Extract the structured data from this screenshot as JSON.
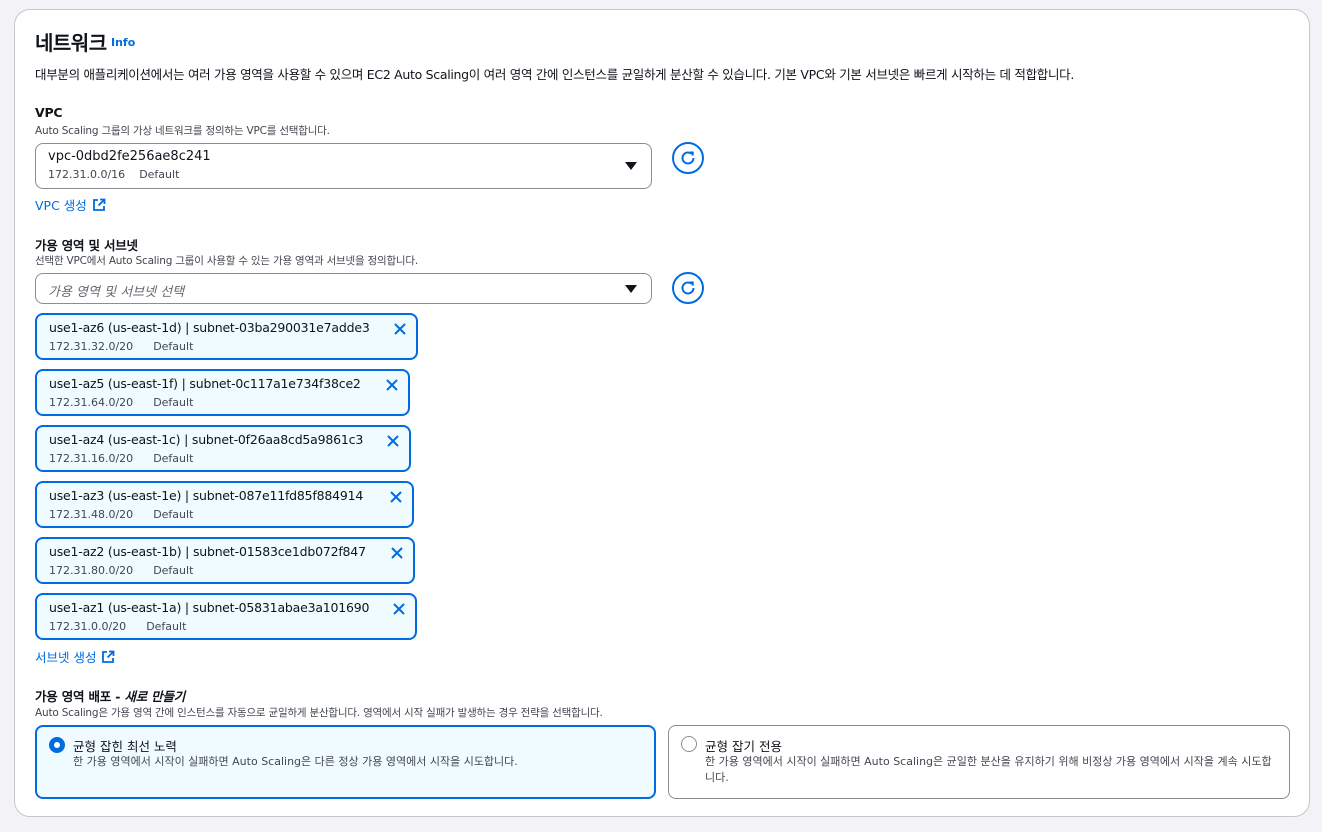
{
  "network": {
    "title": "네트워크",
    "info_link": "Info",
    "description": "대부분의 애플리케이션에서는 여러 가용 영역을 사용할 수 있으며 EC2 Auto Scaling이 여러 영역 간에 인스턴스를 균일하게 분산할 수 있습니다. 기본 VPC와 기본 서브넷은 빠르게 시작하는 데 적합합니다."
  },
  "vpc": {
    "label": "VPC",
    "description": "Auto Scaling 그룹의 가상 네트워크를 정의하는 VPC를 선택합니다.",
    "selected_id": "vpc-0dbd2fe256ae8c241",
    "selected_cidr": "172.31.0.0/16",
    "selected_tag": "Default",
    "create_link": "VPC 생성"
  },
  "subnets": {
    "label": "가용 영역 및 서브넷",
    "description": "선택한 VPC에서 Auto Scaling 그룹이 사용할 수 있는 가용 영역과 서브넷을 정의합니다.",
    "placeholder": "가용 영역 및 서브넷 선택",
    "selected": [
      {
        "name": "use1-az6 (us-east-1d) | subnet-03ba290031e7adde3",
        "cidr": "172.31.32.0/20",
        "tag": "Default"
      },
      {
        "name": "use1-az5 (us-east-1f) | subnet-0c117a1e734f38ce2",
        "cidr": "172.31.64.0/20",
        "tag": "Default"
      },
      {
        "name": "use1-az4 (us-east-1c) | subnet-0f26aa8cd5a9861c3",
        "cidr": "172.31.16.0/20",
        "tag": "Default"
      },
      {
        "name": "use1-az3 (us-east-1e) | subnet-087e11fd85f884914",
        "cidr": "172.31.48.0/20",
        "tag": "Default"
      },
      {
        "name": "use1-az2 (us-east-1b) | subnet-01583ce1db072f847",
        "cidr": "172.31.80.0/20",
        "tag": "Default"
      },
      {
        "name": "use1-az1 (us-east-1a) | subnet-05831abae3a101690",
        "cidr": "172.31.0.0/20",
        "tag": "Default"
      }
    ],
    "create_link": "서브넷 생성"
  },
  "distribution": {
    "label_prefix": "가용 영역 배포 - ",
    "label_new": "새로 만들기",
    "description": "Auto Scaling은 가용 영역 간에 인스턴스를 자동으로 균일하게 분산합니다. 영역에서 시작 실패가 발생하는 경우 전략을 선택합니다.",
    "options": [
      {
        "title": "균형 잡힌 최선 노력",
        "description": "한 가용 영역에서 시작이 실패하면 Auto Scaling은 다른 정상 가용 영역에서 시작을 시도합니다.",
        "selected": true
      },
      {
        "title": "균형 잡기 전용",
        "description": "한 가용 영역에서 시작이 실패하면 Auto Scaling은 균일한 분산을 유지하기 위해 비정상 가용 영역에서 시작을 계속 시도합니다.",
        "selected": false
      }
    ]
  },
  "colors": {
    "accent": "#006ce0",
    "token_bg": "#f0fbff",
    "border": "#8c8c94"
  },
  "icons": [
    "caret-down-icon",
    "refresh-icon",
    "external-link-icon",
    "close-icon",
    "radio-icon"
  ]
}
